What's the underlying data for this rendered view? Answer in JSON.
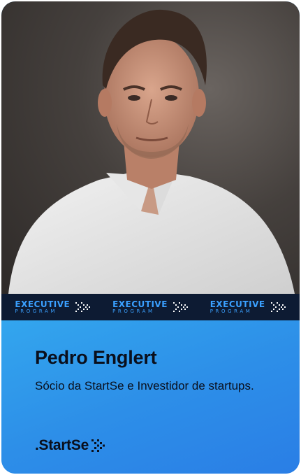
{
  "speaker": {
    "name": "Pedro Englert",
    "role": "Sócio da StartSe e Investidor de startups."
  },
  "program_strip": {
    "items": [
      {
        "title": "EXECUTIVE",
        "subtitle": "PROGRAM"
      },
      {
        "title": "EXECUTIVE",
        "subtitle": "PROGRAM"
      },
      {
        "title": "EXECUTIVE",
        "subtitle": "PROGRAM"
      }
    ]
  },
  "brand": {
    "label": ".StartSe",
    "icon": "chevron-arrows-icon"
  },
  "photo": {
    "subject": "portrait-photo"
  },
  "colors": {
    "card_blue": "#2b95ea",
    "strip_navy": "#0d1b33",
    "strip_accent": "#3aa0ff",
    "text_dark": "#0a0f1c"
  }
}
